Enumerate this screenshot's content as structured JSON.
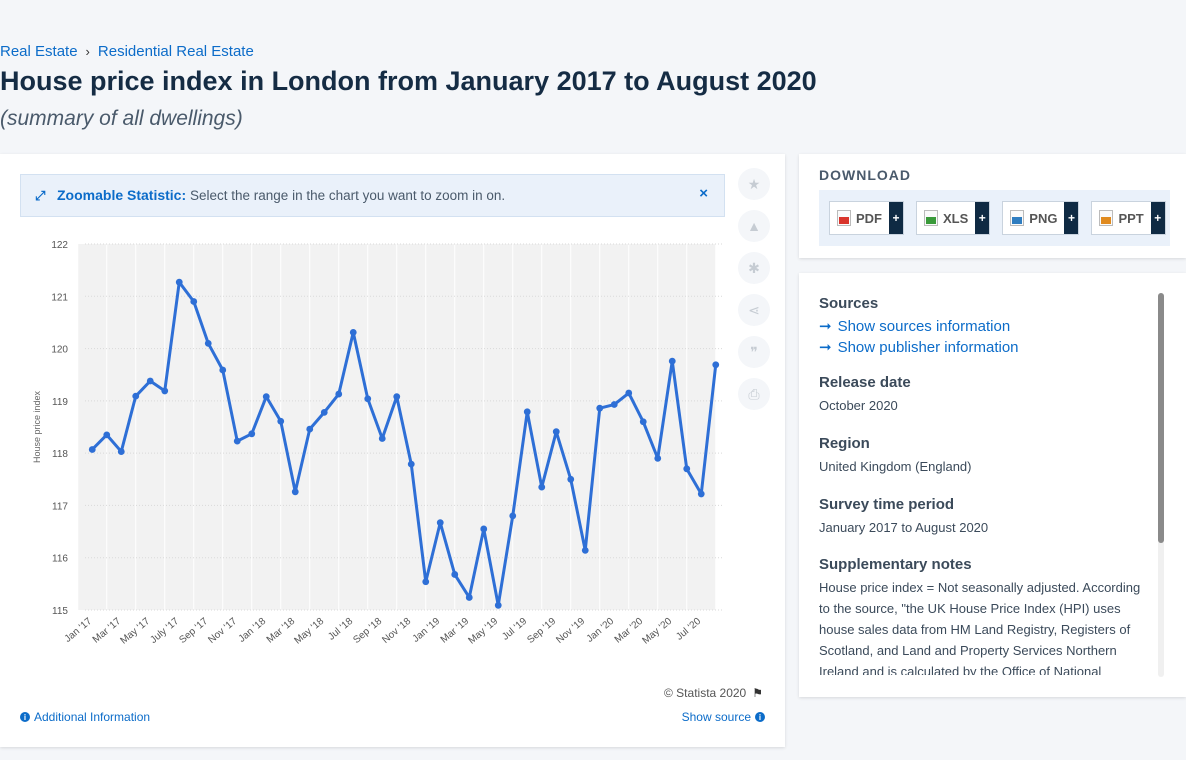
{
  "breadcrumb": {
    "item1": "Real Estate",
    "sep": "›",
    "item2": "Residential Real Estate"
  },
  "title": "House price index in London from January 2017 to August 2020",
  "subtitle": "(summary of all dwellings)",
  "zoom_banner": {
    "label": "Zoomable Statistic:",
    "text": "Select the range in the chart you want to zoom in on.",
    "close": "×"
  },
  "side_icons": [
    "star-icon",
    "bell-icon",
    "gear-icon",
    "share-icon",
    "quote-icon",
    "print-icon"
  ],
  "footer": {
    "copyright": "© Statista 2020",
    "additional_info": "Additional Information",
    "show_source": "Show source"
  },
  "download": {
    "title": "DOWNLOAD",
    "buttons": [
      {
        "label": "PDF",
        "plus": "+",
        "color": "#d9342b"
      },
      {
        "label": "XLS",
        "plus": "+",
        "color": "#3a9a3a"
      },
      {
        "label": "PNG",
        "plus": "+",
        "color": "#2f7dc0"
      },
      {
        "label": "PPT",
        "plus": "+",
        "color": "#e08a1e"
      }
    ]
  },
  "info": {
    "sources_head": "Sources",
    "show_sources": "Show sources information",
    "show_publisher": "Show publisher information",
    "release_head": "Release date",
    "release_val": "October 2020",
    "region_head": "Region",
    "region_val": "United Kingdom (England)",
    "survey_head": "Survey time period",
    "survey_val": "January 2017 to August 2020",
    "supp_head": "Supplementary notes",
    "supp_val": "House price index = Not seasonally adjusted. According to the source, \"the UK House Price Index (HPI) uses house sales data from HM Land Registry, Registers of Scotland, and Land and Property Services Northern Ireland and is calculated by the Office of National Statistics. The index is published"
  },
  "colors": {
    "accent": "#0c6cc9",
    "line": "#2e6fd6",
    "band": "#f2f2f2"
  },
  "chart_data": {
    "type": "line",
    "title": "",
    "xlabel": "",
    "ylabel": "House price index",
    "ylim": [
      115,
      122
    ],
    "yticks": [
      115,
      116,
      117,
      118,
      119,
      120,
      121,
      122
    ],
    "grid": true,
    "x": [
      "Jan '17",
      "Feb '17",
      "Mar '17",
      "Apr '17",
      "May '17",
      "Jun '17",
      "July '17",
      "Aug '17",
      "Sep '17",
      "Oct '17",
      "Nov '17",
      "Dec '17",
      "Jan '18",
      "Feb '18",
      "Mar '18",
      "Apr '18",
      "May '18",
      "Jun '18",
      "Jul '18",
      "Aug '18",
      "Sep '18",
      "Oct '18",
      "Nov '18",
      "Dec '18",
      "Jan '19",
      "Feb '19",
      "Mar '19",
      "Apr '19",
      "May '19",
      "Jun '19",
      "Jul '19",
      "Aug '19",
      "Sep '19",
      "Oct '19",
      "Nov '19",
      "Dec '19",
      "Jan '20",
      "Feb '20",
      "Mar '20",
      "Apr '20",
      "May '20",
      "Jun '20",
      "Jul '20",
      "Aug '20"
    ],
    "xtick_labels": [
      "Jan '17",
      "Mar '17",
      "May '17",
      "July '17",
      "Sep '17",
      "Nov '17",
      "Jan '18",
      "Mar '18",
      "May '18",
      "Jul '18",
      "Sep '18",
      "Nov '18",
      "Jan '19",
      "Mar '19",
      "May '19",
      "Jul '19",
      "Sep '19",
      "Nov '19",
      "Jan '20",
      "Mar '20",
      "May '20",
      "Jul '20"
    ],
    "series": [
      {
        "values": [
          118.07,
          118.35,
          118.03,
          119.09,
          119.38,
          119.19,
          121.27,
          120.9,
          120.1,
          119.59,
          118.23,
          118.37,
          119.08,
          118.61,
          117.26,
          118.46,
          118.78,
          119.13,
          120.31,
          119.04,
          118.28,
          119.08,
          117.79,
          115.54,
          116.67,
          115.68,
          115.24,
          116.55,
          115.09,
          116.8,
          118.79,
          117.35,
          118.41,
          117.5,
          116.14,
          118.86,
          118.93,
          119.15,
          118.6,
          117.9,
          119.76,
          117.7,
          117.22,
          119.69
        ]
      }
    ]
  }
}
